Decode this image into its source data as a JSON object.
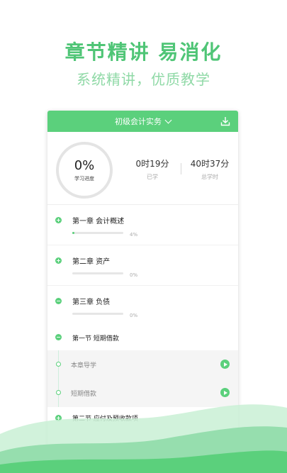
{
  "hero": {
    "title": "章节精讲  易消化",
    "subtitle": "系统精讲，优质教学"
  },
  "header": {
    "subject": "初级会计实务",
    "download_icon": "download-icon",
    "chevron_icon": "chevron-down-icon",
    "accent": "#5bd07c"
  },
  "stats": {
    "progress_value": "0%",
    "progress_label": "学习进度",
    "studied_value": "0时19分",
    "studied_label": "已学",
    "total_value": "40时37分",
    "total_label": "总学时"
  },
  "chapters": [
    {
      "title": "第一章 会计概述",
      "percent": "4%",
      "progress": 0.04,
      "icon": "+"
    },
    {
      "title": "第二章 资产",
      "percent": "0%",
      "progress": 0,
      "icon": "+"
    },
    {
      "title": "第三章 负债",
      "percent": "0%",
      "progress": 0,
      "icon": "−"
    }
  ],
  "section_open": {
    "title": "第一节 短期借款",
    "icon": "−"
  },
  "lessons": [
    {
      "label": "本章导学"
    },
    {
      "label": "短期借款"
    }
  ],
  "section_next": {
    "title": "第二节 应付及预收款项",
    "icon": "+"
  }
}
